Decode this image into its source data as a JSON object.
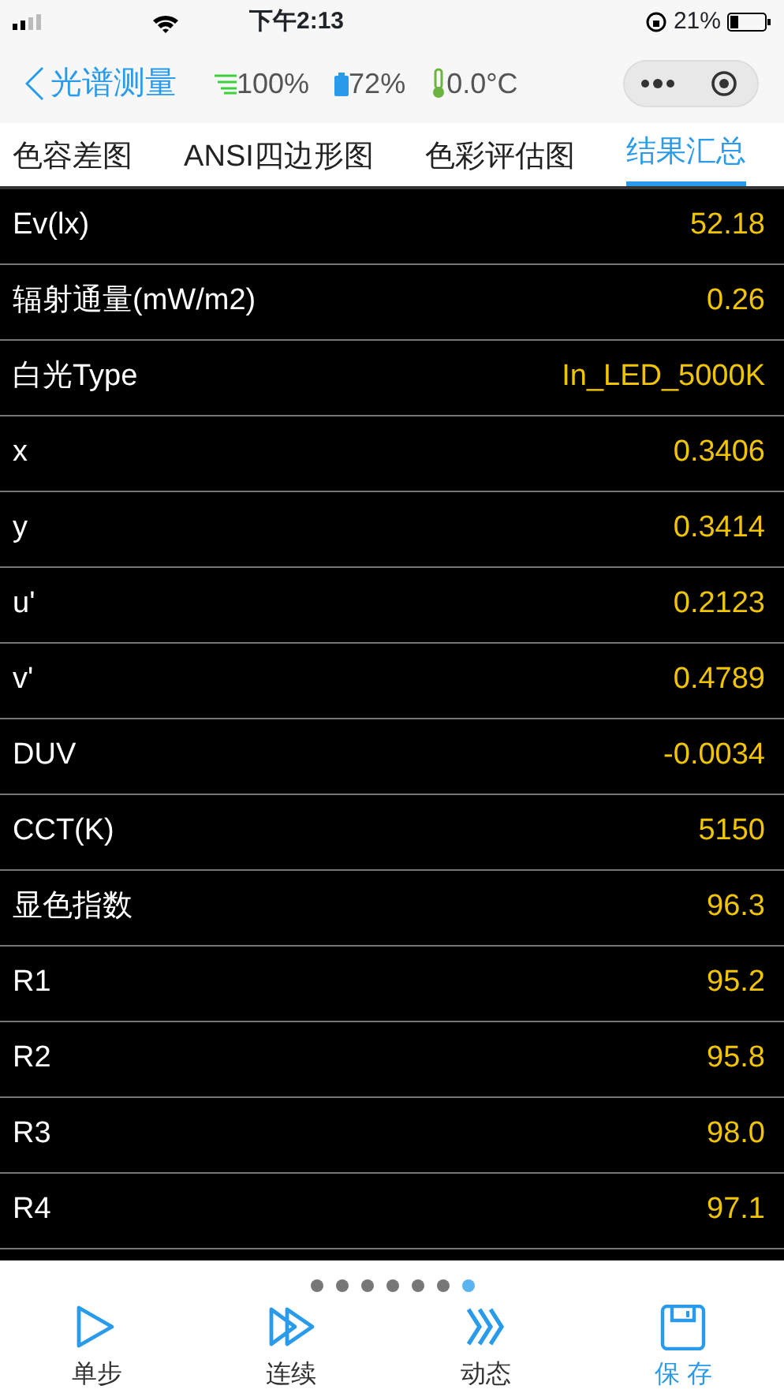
{
  "status_bar": {
    "time": "下午2:13",
    "battery_text": "21%"
  },
  "header": {
    "back_label": "光谱测量",
    "signal": "100%",
    "battery": "72%",
    "temperature": "0.0°C"
  },
  "tabs": [
    {
      "label": "色容差图",
      "selected": false
    },
    {
      "label": "ANSI四边形图",
      "selected": false
    },
    {
      "label": "色彩评估图",
      "selected": false
    },
    {
      "label": "结果汇总",
      "selected": true
    }
  ],
  "rows": [
    {
      "name": "Ev(lx)",
      "value": "52.18"
    },
    {
      "name": "辐射通量(mW/m2)",
      "value": "0.26"
    },
    {
      "name": "白光Type",
      "value": "In_LED_5000K"
    },
    {
      "name": "x",
      "value": "0.3406"
    },
    {
      "name": "y",
      "value": "0.3414"
    },
    {
      "name": "u'",
      "value": "0.2123"
    },
    {
      "name": "v'",
      "value": "0.4789"
    },
    {
      "name": "DUV",
      "value": "-0.0034"
    },
    {
      "name": "CCT(K)",
      "value": "5150"
    },
    {
      "name": "显色指数",
      "value": "96.3"
    },
    {
      "name": "R1",
      "value": "95.2"
    },
    {
      "name": "R2",
      "value": "95.8"
    },
    {
      "name": "R3",
      "value": "98.0"
    },
    {
      "name": "R4",
      "value": "97.1"
    }
  ],
  "page_dots": [
    {
      "selected": false
    },
    {
      "selected": false
    },
    {
      "selected": false
    },
    {
      "selected": false
    },
    {
      "selected": false
    },
    {
      "selected": false
    },
    {
      "selected": true
    }
  ],
  "bottom_nav": [
    {
      "kind": "play",
      "label": "单步",
      "selected": false
    },
    {
      "kind": "double-play",
      "label": "连续",
      "selected": false
    },
    {
      "kind": "chevrons",
      "label": "动态",
      "selected": false
    },
    {
      "kind": "save",
      "label": "保 存",
      "selected": true
    }
  ]
}
